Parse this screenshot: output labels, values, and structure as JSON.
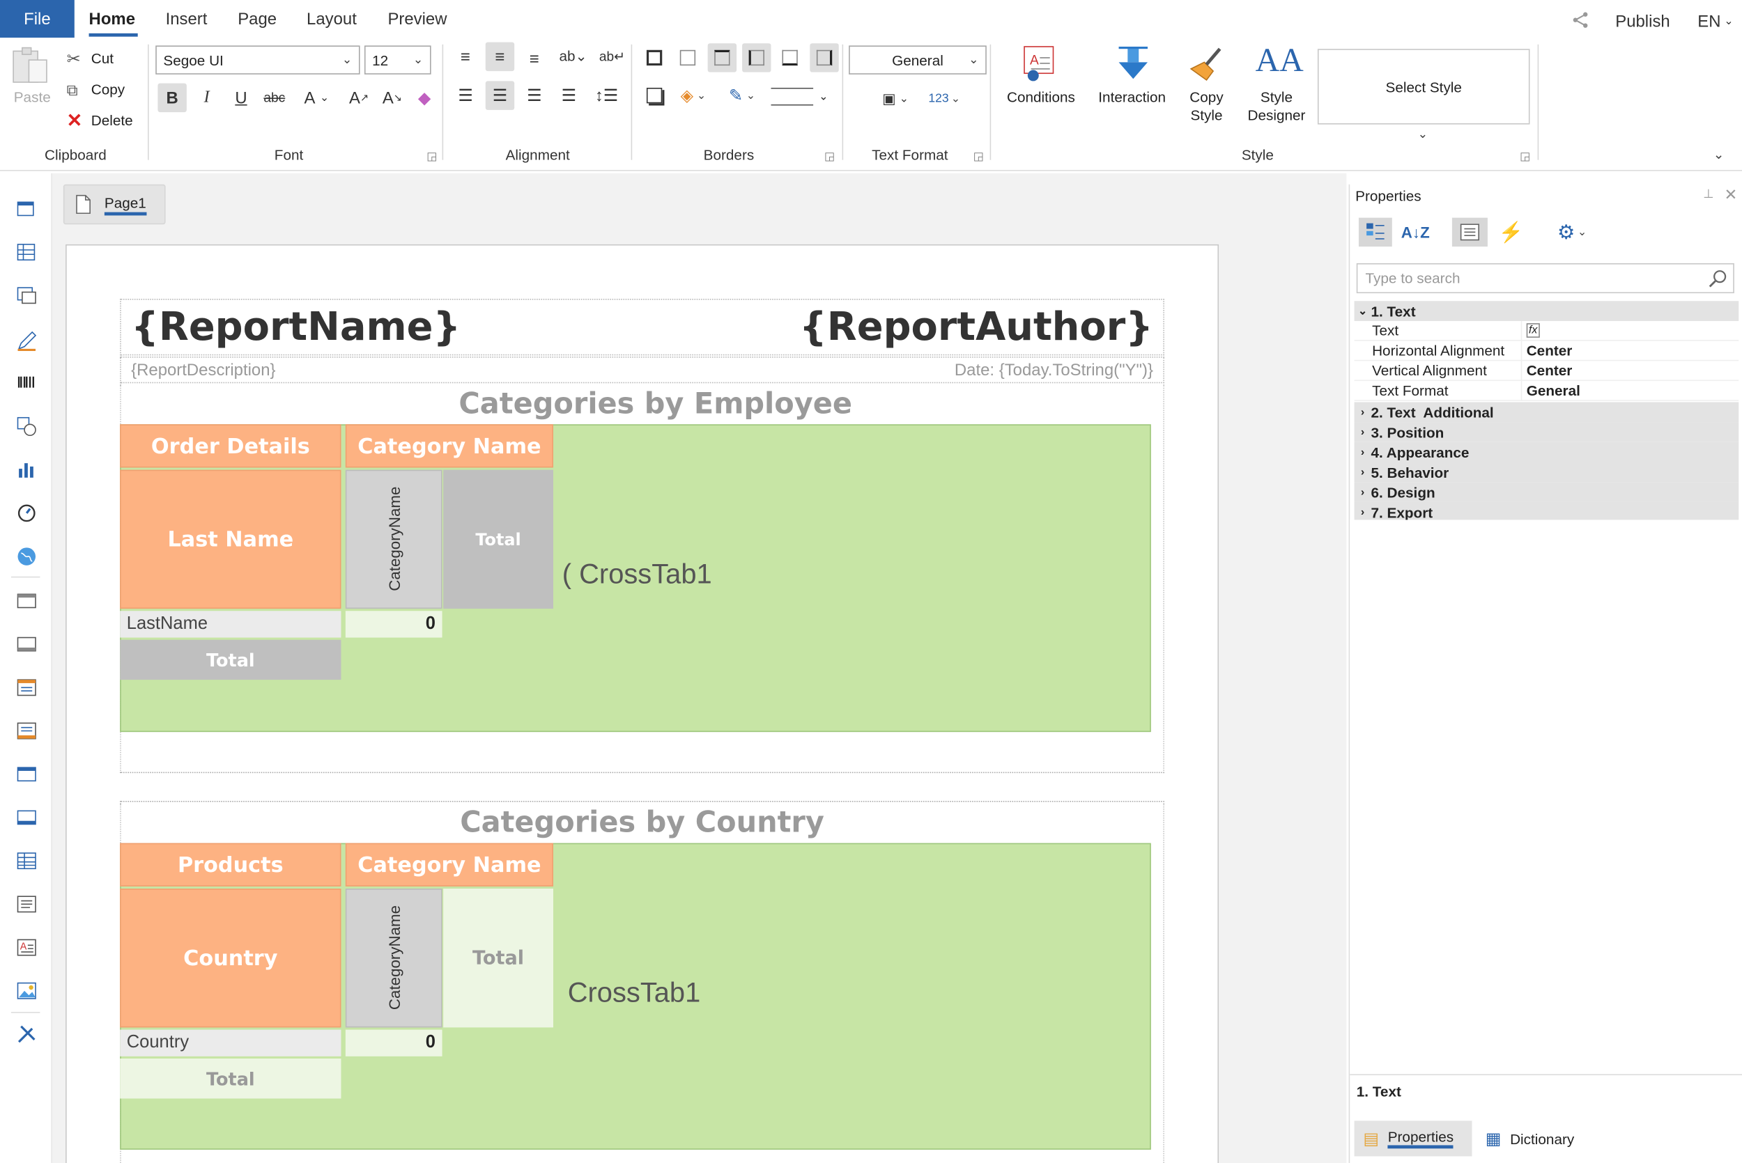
{
  "tabs": {
    "file": "File",
    "home": "Home",
    "insert": "Insert",
    "page": "Page",
    "layout": "Layout",
    "preview": "Preview"
  },
  "topright": {
    "publish": "Publish",
    "lang": "EN"
  },
  "clipboard": {
    "paste": "Paste",
    "cut": "Cut",
    "copy": "Copy",
    "delete": "Delete",
    "group": "Clipboard"
  },
  "font": {
    "family": "Segoe UI",
    "size": "12",
    "group": "Font"
  },
  "alignment": {
    "group": "Alignment"
  },
  "borders": {
    "group": "Borders"
  },
  "textformat": {
    "value": "General",
    "group": "Text Format"
  },
  "style": {
    "conditions": "Conditions",
    "interaction": "Interaction",
    "copy_style_1": "Copy",
    "copy_style_2": "Style",
    "designer_1": "Style",
    "designer_2": "Designer",
    "select_style": "Select Style",
    "group": "Style"
  },
  "page_tab": "Page1",
  "report": {
    "name": "{ReportName}",
    "author": "{ReportAuthor}",
    "description": "{ReportDescription}",
    "date": "Date: {Today.ToString(\"Y\")}",
    "sec1": {
      "title": "Categories by Employee",
      "header_left": "Order Details",
      "header_right": "Category Name",
      "row_header": "Last Name",
      "vertical": "CategoryName",
      "total_col": "Total",
      "crosstab": "CrossTab1",
      "crosstab_prefix": "(",
      "row_field": "LastName",
      "value": "0",
      "total_row": "Total"
    },
    "sec2": {
      "title": "Categories by Country",
      "header_left": "Products",
      "header_right": "Category Name",
      "row_header": "Country",
      "vertical": "CategoryName",
      "total_col": "Total",
      "crosstab": "CrossTab1",
      "row_field": "Country",
      "value": "0",
      "total_row": "Total"
    }
  },
  "properties": {
    "title": "Properties",
    "search_placeholder": "Type to search",
    "cat1": "1. Text",
    "rows": [
      {
        "name": "Text",
        "value": ""
      },
      {
        "name": "Horizontal Alignment",
        "value": "Center"
      },
      {
        "name": "Vertical Alignment",
        "value": "Center"
      },
      {
        "name": "Text Format",
        "value": "General"
      }
    ],
    "cats": [
      "2. Text  Additional",
      "3. Position",
      "4. Appearance",
      "5. Behavior",
      "6. Design",
      "7. Export"
    ],
    "footer": "1. Text",
    "tab_properties": "Properties",
    "tab_dictionary": "Dictionary"
  },
  "colors": {
    "accent": "#2b65ad",
    "orange": "#fdb282",
    "green": "#c7e5a5"
  }
}
